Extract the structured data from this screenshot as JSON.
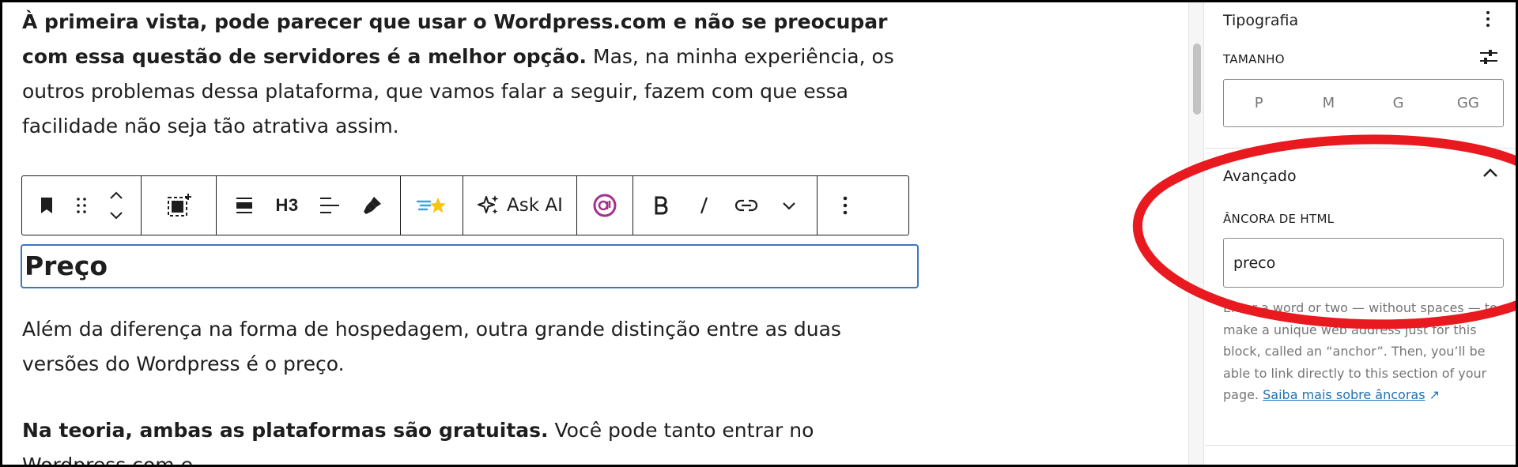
{
  "content": {
    "p1_bold": "À primeira vista, pode parecer que usar o Wordpress.com e não se preocupar com essa questão de servidores é a melhor opção.",
    "p1_text": " Mas, na minha experiência, os outros problemas dessa plataforma, que vamos falar a seguir, fazem com que essa facilidade não seja tão atrativa assim.",
    "heading": "Preço",
    "p2_text": "Além da diferença na forma de hospedagem, outra grande distinção entre as duas versões do Wordpress é o preço.",
    "p3_bold": "Na teoria, ambas as plataformas são gratuitas.",
    "p3_text": " Você pode tanto entrar no Wordpress.com e"
  },
  "toolbar": {
    "heading_level": "H3",
    "ask_ai_label": "Ask AI",
    "icons": [
      "bookmark-icon",
      "drag-handle-icon",
      "move-up-down-icon",
      "select-parent-icon",
      "align-icon",
      "heading-level-icon",
      "text-align-icon",
      "highlighter-icon",
      "sparkle-star-icon",
      "ask-ai-icon",
      "ai-circle-icon",
      "bold-icon",
      "italic-icon",
      "link-icon",
      "chevron-down-icon",
      "more-options-icon"
    ]
  },
  "sidebar": {
    "typography_title": "Tipografia",
    "size_label": "TAMANHO",
    "sizes": [
      "P",
      "M",
      "G",
      "GG"
    ],
    "advanced_title": "Avançado",
    "anchor_label": "ÂNCORA DE HTML",
    "anchor_value": "preco",
    "help_text": "Enter a word or two — without spaces — to make a unique web address just for this block, called an “anchor”. Then, you’ll be able to link directly to this section of your page.",
    "help_link": "Saiba mais sobre âncoras",
    "link_arrow": "↗"
  },
  "colors": {
    "annotation": "#e8191f",
    "link": "#2271b1",
    "selection_border": "#3a76c4"
  }
}
